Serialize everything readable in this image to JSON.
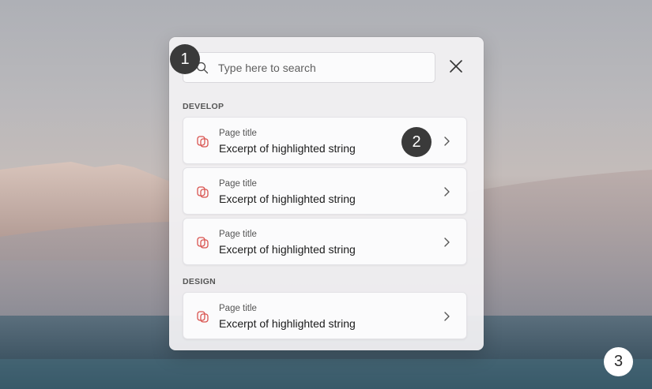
{
  "search": {
    "placeholder": "Type here to search",
    "value": ""
  },
  "sections": [
    {
      "header": "DEVELOP",
      "items": [
        {
          "label": "Page title",
          "text": "Excerpt of highlighted string"
        },
        {
          "label": "Page title",
          "text": "Excerpt of highlighted string"
        },
        {
          "label": "Page title",
          "text": "Excerpt of highlighted string"
        }
      ]
    },
    {
      "header": "DESIGN",
      "items": [
        {
          "label": "Page title",
          "text": "Excerpt of highlighted string"
        }
      ]
    }
  ],
  "callouts": [
    "1",
    "2",
    "3"
  ],
  "icons": {
    "search": "search-icon",
    "close": "close-icon",
    "page": "page-icon",
    "chevron": "chevron-right-icon"
  },
  "colors": {
    "accent_icon": "#d9534f",
    "callout_dark": "#3a3a3a"
  }
}
